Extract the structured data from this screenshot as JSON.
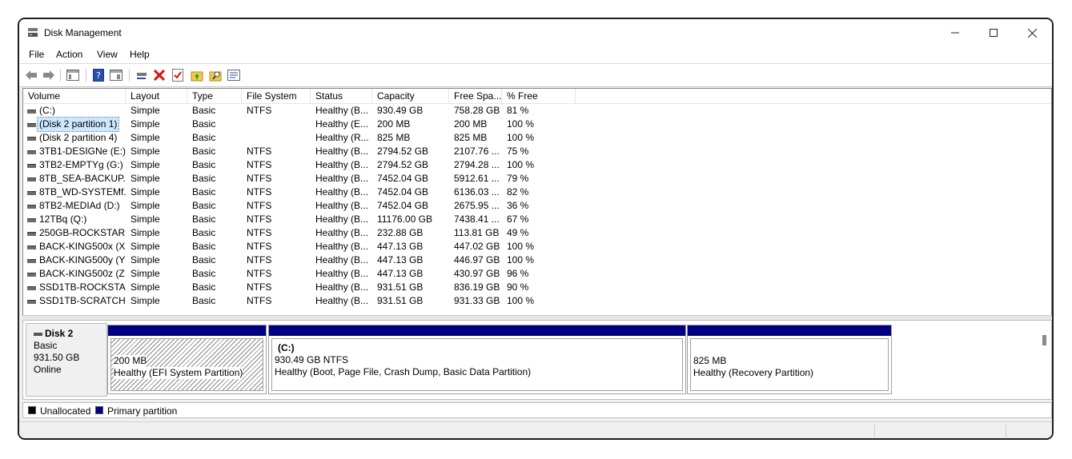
{
  "window": {
    "title": "Disk Management"
  },
  "menu": [
    "File",
    "Action",
    "View",
    "Help"
  ],
  "columns": [
    "Volume",
    "Layout",
    "Type",
    "File System",
    "Status",
    "Capacity",
    "Free Spa...",
    "% Free"
  ],
  "rows": [
    [
      "(C:)",
      "Simple",
      "Basic",
      "NTFS",
      "Healthy (B...",
      "930.49 GB",
      "758.28 GB",
      "81 %"
    ],
    [
      "(Disk 2 partition 1)",
      "Simple",
      "Basic",
      "",
      "Healthy (E...",
      "200 MB",
      "200 MB",
      "100 %"
    ],
    [
      "(Disk 2 partition 4)",
      "Simple",
      "Basic",
      "",
      "Healthy (R...",
      "825 MB",
      "825 MB",
      "100 %"
    ],
    [
      "3TB1-DESIGNe (E:)",
      "Simple",
      "Basic",
      "NTFS",
      "Healthy (B...",
      "2794.52 GB",
      "2107.76 ...",
      "75 %"
    ],
    [
      "3TB2-EMPTYg (G:)",
      "Simple",
      "Basic",
      "NTFS",
      "Healthy (B...",
      "2794.52 GB",
      "2794.28 ...",
      "100 %"
    ],
    [
      "8TB_SEA-BACKUP...",
      "Simple",
      "Basic",
      "NTFS",
      "Healthy (B...",
      "7452.04 GB",
      "5912.61 ...",
      "79 %"
    ],
    [
      "8TB_WD-SYSTEMf...",
      "Simple",
      "Basic",
      "NTFS",
      "Healthy (B...",
      "7452.04 GB",
      "6136.03 ...",
      "82 %"
    ],
    [
      "8TB2-MEDIAd (D:)",
      "Simple",
      "Basic",
      "NTFS",
      "Healthy (B...",
      "7452.04 GB",
      "2675.95 ...",
      "36 %"
    ],
    [
      "12TBq (Q:)",
      "Simple",
      "Basic",
      "NTFS",
      "Healthy (B...",
      "11176.00 GB",
      "7438.41 ...",
      "67 %"
    ],
    [
      "250GB-ROCKSTAR...",
      "Simple",
      "Basic",
      "NTFS",
      "Healthy (B...",
      "232.88 GB",
      "113.81 GB",
      "49 %"
    ],
    [
      "BACK-KING500x (X:)",
      "Simple",
      "Basic",
      "NTFS",
      "Healthy (B...",
      "447.13 GB",
      "447.02 GB",
      "100 %"
    ],
    [
      "BACK-KING500y (Y:)",
      "Simple",
      "Basic",
      "NTFS",
      "Healthy (B...",
      "447.13 GB",
      "446.97 GB",
      "100 %"
    ],
    [
      "BACK-KING500z (Z:)",
      "Simple",
      "Basic",
      "NTFS",
      "Healthy (B...",
      "447.13 GB",
      "430.97 GB",
      "96 %"
    ],
    [
      "SSD1TB-ROCKSTA...",
      "Simple",
      "Basic",
      "NTFS",
      "Healthy (B...",
      "931.51 GB",
      "836.19 GB",
      "90 %"
    ],
    [
      "SSD1TB-SCRATCH...",
      "Simple",
      "Basic",
      "NTFS",
      "Healthy (B...",
      "931.51 GB",
      "931.33 GB",
      "100 %"
    ]
  ],
  "selected_row": 1,
  "disk": {
    "name": "Disk 2",
    "type": "Basic",
    "size": "931.50 GB",
    "state": "Online",
    "partitions": [
      {
        "label": "",
        "size": "200 MB",
        "status": "Healthy (EFI System Partition)",
        "hatched": true
      },
      {
        "label": "(C:)",
        "size": "930.49 GB NTFS",
        "status": "Healthy (Boot, Page File, Crash Dump, Basic Data Partition)",
        "hatched": false
      },
      {
        "label": "",
        "size": "825 MB",
        "status": "Healthy (Recovery Partition)",
        "hatched": false
      }
    ]
  },
  "legend": [
    {
      "label": "Unallocated",
      "color": "#000000"
    },
    {
      "label": "Primary partition",
      "color": "#000080"
    }
  ],
  "colors": {
    "partition_bar": "#000080",
    "selection": "#cce8ff"
  }
}
